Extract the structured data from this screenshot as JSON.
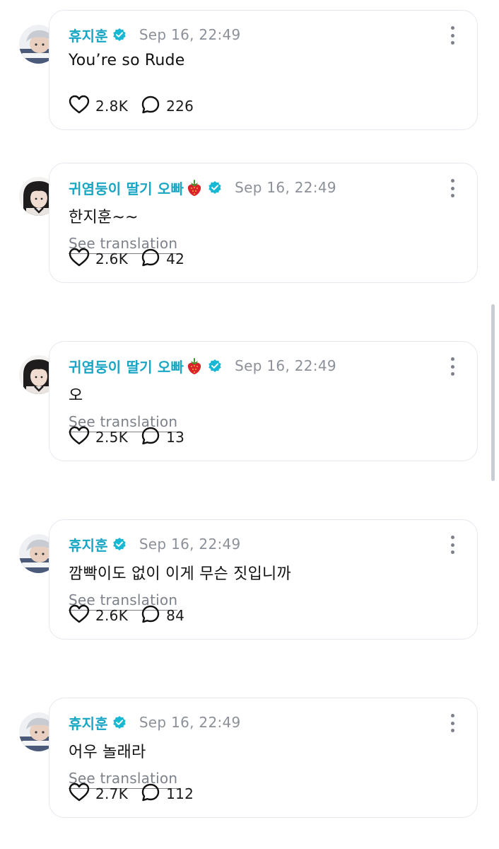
{
  "colors": {
    "name": "#18a6c4",
    "verified": "#18b8d4",
    "timestamp": "#8c9199",
    "card_border": "#e6e8ef"
  },
  "icons": {
    "like": "heart-icon",
    "reply": "reply-bubble-icon",
    "verified": "verified-badge-icon",
    "more": "more-options-icon",
    "emoji": "strawberry-emoji"
  },
  "comments": [
    {
      "author": "휴지훈",
      "time": "Sep 16, 22:49",
      "text": "You’re so Rude",
      "likes": "2.8K",
      "replies": "226"
    },
    {
      "author": "귀염둥이 딸기 오빠",
      "time": "Sep 16, 22:49",
      "text": "한지훈~~",
      "translate": "See translation",
      "likes": "2.6K",
      "replies": "42"
    },
    {
      "author": "귀염둥이 딸기 오빠",
      "time": "Sep 16, 22:49",
      "text": "오",
      "translate": "See translation",
      "likes": "2.5K",
      "replies": "13"
    },
    {
      "author": "휴지훈",
      "time": "Sep 16, 22:49",
      "text": "깜빡이도 없이 이게 무슨 짓입니까",
      "translate": "See translation",
      "likes": "2.6K",
      "replies": "84"
    },
    {
      "author": "휴지훈",
      "time": "Sep 16, 22:49",
      "text": "어우 놀래라",
      "translate": "See translation",
      "likes": "2.7K",
      "replies": "112"
    }
  ]
}
